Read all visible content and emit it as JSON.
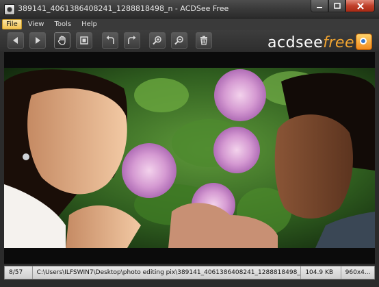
{
  "window": {
    "title": "389141_40613864082​41_1288818498_n - ACDSee Free"
  },
  "menu": [
    "File",
    "View",
    "Tools",
    "Help"
  ],
  "toolbar": {
    "buttons": [
      "previous-icon",
      "next-icon",
      "hand-tool-icon",
      "fit-screen-icon",
      "rotate-left-icon",
      "rotate-right-icon",
      "zoom-in-icon",
      "zoom-out-icon",
      "delete-icon"
    ]
  },
  "logo": {
    "brand": "acdsee",
    "edition": "free"
  },
  "status": {
    "index": "8/57",
    "path": "C:\\Users\\ILFSWIN7\\Desktop\\photo editing pix\\389141_406138640​8241_1288818498_n.jpg",
    "size": "104.9 KB",
    "dimensions": "960x4..."
  },
  "colors": {
    "accent": "#f2a531",
    "menu_active": "#f2c24e",
    "close": "#c0402a"
  }
}
